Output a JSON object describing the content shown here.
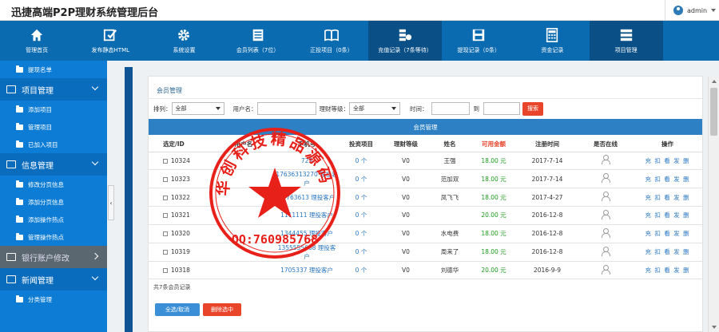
{
  "header": {
    "title": "迅捷高端P2P理财系统管理后台",
    "user": "admin"
  },
  "nav": [
    {
      "label": "管理首页",
      "icon": "home-icon"
    },
    {
      "label": "发布静态HTML",
      "icon": "edit-icon"
    },
    {
      "label": "系统设置",
      "icon": "gear-icon"
    },
    {
      "label": "会员列表（7位）",
      "icon": "document-icon"
    },
    {
      "label": "正投项目（0条）",
      "icon": "book-icon"
    },
    {
      "label": "充值记录（7条等待）",
      "icon": "database-icon"
    },
    {
      "label": "提现记录（0条）",
      "icon": "save-icon"
    },
    {
      "label": "资金记录",
      "icon": "calculator-icon"
    },
    {
      "label": "项目管理",
      "icon": "list-icon"
    }
  ],
  "sidebar": {
    "sub_top": "提现名单",
    "group1": {
      "title": "项目管理",
      "items": [
        "添加项目",
        "管理项目",
        "已加入项目"
      ]
    },
    "group2": {
      "title": "信息管理",
      "items": [
        "修改分页信息",
        "添加分页信息",
        "添加操作热点",
        "管理操作热点"
      ]
    },
    "group3": {
      "title": "银行账户修改"
    },
    "group4": {
      "title": "新闻管理",
      "items": [
        "分类管理"
      ]
    }
  },
  "panel": {
    "title": "会员管理",
    "filters": {
      "sort_label": "排列：",
      "sort_value": "全部",
      "username_label": "用户名：",
      "level_label": "理财等级：",
      "level_value": "全部",
      "time_label": "时间：",
      "to_label": "到",
      "search_button": "搜索"
    },
    "table_title": "会员管理",
    "columns": [
      "选定/ID",
      "用户名",
      "手机号",
      "投资项目",
      "理财等级",
      "姓名",
      "可用金额",
      "注册时间",
      "是否在线",
      "操作"
    ],
    "rows": [
      {
        "id": "10324",
        "username": "",
        "phone": "723",
        "invest": "0 个",
        "level": "V0",
        "name": "王强",
        "amount": "18.00 元",
        "date": "2017-7-14"
      },
      {
        "id": "10323",
        "username": "",
        "phone": "17636313270 理投客户",
        "invest": "0 个",
        "level": "V0",
        "name": "范加双",
        "amount": "18.00 元",
        "date": "2017-7-14"
      },
      {
        "id": "10322",
        "username": "",
        "phone": "17763613 理投客户",
        "invest": "0 个",
        "level": "V0",
        "name": "凤飞飞",
        "amount": "18.00 元",
        "date": "2017-4-27"
      },
      {
        "id": "10321",
        "username": "",
        "phone": "1111111 理投客户",
        "invest": "0 个",
        "level": "V0",
        "name": "",
        "amount": "20.00 元",
        "date": "2016-12-8"
      },
      {
        "id": "10320",
        "username": "",
        "phone": "1344455 理投客户",
        "invest": "0 个",
        "level": "V0",
        "name": "水电费",
        "amount": "18.00 元",
        "date": "2016-12-8"
      },
      {
        "id": "10319",
        "username": "",
        "phone": "1355555668 理投客户",
        "invest": "0 个",
        "level": "V0",
        "name": "周来了",
        "amount": "18.00 元",
        "date": "2016-12-8"
      },
      {
        "id": "10318",
        "username": "",
        "phone": "1705337 理投客户",
        "invest": "0 个",
        "level": "V0",
        "name": "刘德华",
        "amount": "20.00 元",
        "date": "2016-9-9"
      }
    ],
    "ops": "充 扣 看 发 删",
    "summary": "共7条会员记录",
    "select_all_button": "全选/取消",
    "delete_button": "删除选中"
  },
  "seal": {
    "text": "华创科技精品源码",
    "qq": "QQ:760985768",
    "color": "#e8201a"
  },
  "colors": {
    "nav_bg": "#0b6bb0",
    "sidebar_bg": "#0c7cd5",
    "accent_red": "#e8452b",
    "table_head": "#2c80c3"
  }
}
